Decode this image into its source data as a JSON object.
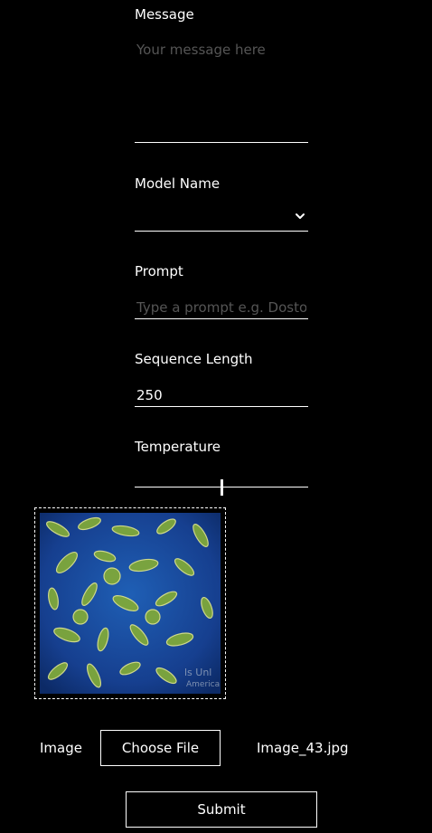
{
  "form": {
    "message": {
      "label": "Message",
      "placeholder": "Your message here",
      "value": ""
    },
    "model_name": {
      "label": "Model Name",
      "selected": ""
    },
    "prompt": {
      "label": "Prompt",
      "placeholder": "Type a prompt e.g. Dostoevsky",
      "value": ""
    },
    "sequence_length": {
      "label": "Sequence Length",
      "value": "250"
    },
    "temperature": {
      "label": "Temperature",
      "level_fraction": 0.5
    },
    "image": {
      "label": "Image",
      "choose_label": "Choose File",
      "file_name": "Image_43.jpg",
      "preview_watermark": "Visuals Unlimited / America",
      "preview_icon": "microscope-image"
    },
    "submit_label": "Submit"
  }
}
